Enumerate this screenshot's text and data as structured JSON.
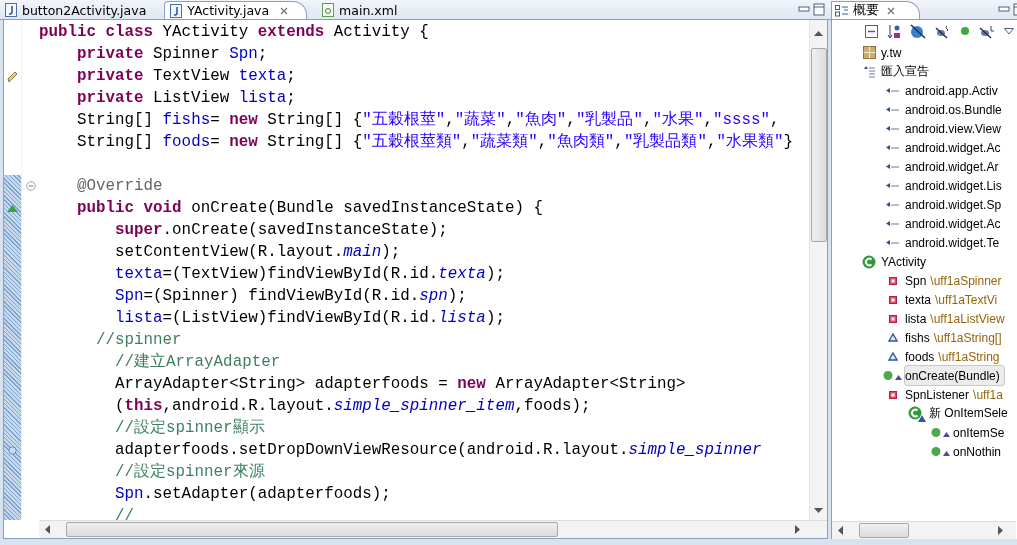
{
  "editor": {
    "tabs": [
      {
        "label": "button2Activity.java",
        "kind": "java",
        "selected": false
      },
      {
        "label": "YActivity.java",
        "kind": "java",
        "selected": true
      },
      {
        "label": "main.xml",
        "kind": "xml",
        "selected": false
      }
    ],
    "blocks": [
      {
        "in_range": false,
        "lines": [
          {
            "kind": "plain",
            "segments": [
              {
                "text": "public class ",
                "kind": "keyword"
              },
              {
                "text": "YActivity ",
                "kind": "plain"
              },
              {
                "text": "extends ",
                "kind": "keyword"
              },
              {
                "text": "Activity {",
                "kind": "plain"
              }
            ]
          },
          {
            "kind": "plain",
            "segments": [
              {
                "text": "    private ",
                "kind": "keyword"
              },
              {
                "text": "Spinner ",
                "kind": "plain"
              },
              {
                "text": "Spn",
                "kind": "field"
              },
              {
                "text": ";",
                "kind": "plain"
              }
            ]
          },
          {
            "kind": "task",
            "segments": [
              {
                "text": "    private ",
                "kind": "keyword"
              },
              {
                "text": "TextView ",
                "kind": "plain"
              },
              {
                "text": "texta",
                "kind": "field"
              },
              {
                "text": ";",
                "kind": "plain"
              }
            ]
          },
          {
            "kind": "plain",
            "segments": [
              {
                "text": "    private ",
                "kind": "keyword"
              },
              {
                "text": "ListView ",
                "kind": "plain"
              },
              {
                "text": "lista",
                "kind": "field"
              },
              {
                "text": ";",
                "kind": "plain"
              }
            ]
          },
          {
            "kind": "plain",
            "segments": [
              {
                "text": "    String[] ",
                "kind": "plain"
              },
              {
                "text": "fishs",
                "kind": "field"
              },
              {
                "text": "= ",
                "kind": "plain"
              },
              {
                "text": "new ",
                "kind": "keyword"
              },
              {
                "text": "String[] {",
                "kind": "plain"
              },
              {
                "text": "\"五穀根莖\"",
                "kind": "string"
              },
              {
                "text": ",",
                "kind": "plain"
              },
              {
                "text": "\"蔬菜\"",
                "kind": "string"
              },
              {
                "text": ",",
                "kind": "plain"
              },
              {
                "text": "\"魚肉\"",
                "kind": "string"
              },
              {
                "text": ",",
                "kind": "plain"
              },
              {
                "text": "\"乳製品\"",
                "kind": "string"
              },
              {
                "text": ",",
                "kind": "plain"
              },
              {
                "text": "\"水果\"",
                "kind": "string"
              },
              {
                "text": ",",
                "kind": "plain"
              },
              {
                "text": "\"ssss\"",
                "kind": "string"
              },
              {
                "text": ",",
                "kind": "plain"
              }
            ]
          },
          {
            "kind": "plain",
            "segments": [
              {
                "text": "    String[] ",
                "kind": "plain"
              },
              {
                "text": "foods",
                "kind": "field"
              },
              {
                "text": "= ",
                "kind": "plain"
              },
              {
                "text": "new ",
                "kind": "keyword"
              },
              {
                "text": "String[] {",
                "kind": "plain"
              },
              {
                "text": "\"五穀根莖類\"",
                "kind": "string"
              },
              {
                "text": ",",
                "kind": "plain"
              },
              {
                "text": "\"蔬菜類\"",
                "kind": "string"
              },
              {
                "text": ",",
                "kind": "plain"
              },
              {
                "text": "\"魚肉類\"",
                "kind": "string"
              },
              {
                "text": ",",
                "kind": "plain"
              },
              {
                "text": "\"乳製品類\"",
                "kind": "string"
              },
              {
                "text": ",",
                "kind": "plain"
              },
              {
                "text": "\"水果類\"",
                "kind": "string"
              },
              {
                "text": "}",
                "kind": "plain"
              }
            ]
          },
          {
            "kind": "plain"
          }
        ]
      },
      {
        "in_range": true,
        "lines": [
          {
            "kind": "fold",
            "segments": [
              {
                "text": "    @Override",
                "kind": "annotation"
              }
            ]
          },
          {
            "kind": "override",
            "segments": [
              {
                "text": "    public void ",
                "kind": "keyword"
              },
              {
                "text": "onCreate(Bundle savedInstanceState) {",
                "kind": "plain"
              }
            ]
          },
          {
            "kind": "plain",
            "segments": [
              {
                "text": "        super",
                "kind": "keyword"
              },
              {
                "text": ".onCreate(savedInstanceState);",
                "kind": "plain"
              }
            ]
          },
          {
            "kind": "plain",
            "segments": [
              {
                "text": "        setContentView(R.layout.",
                "kind": "plain"
              },
              {
                "text": "main",
                "kind": "static"
              },
              {
                "text": ");",
                "kind": "plain"
              }
            ]
          },
          {
            "kind": "plain",
            "segments": [
              {
                "text": "        texta",
                "kind": "field"
              },
              {
                "text": "=(TextView)findViewById(R.id.",
                "kind": "plain"
              },
              {
                "text": "texta",
                "kind": "static"
              },
              {
                "text": ");",
                "kind": "plain"
              }
            ]
          },
          {
            "kind": "plain",
            "segments": [
              {
                "text": "        Spn",
                "kind": "field"
              },
              {
                "text": "=(Spinner) findViewById(R.id.",
                "kind": "plain"
              },
              {
                "text": "spn",
                "kind": "static"
              },
              {
                "text": ");",
                "kind": "plain"
              }
            ]
          },
          {
            "kind": "plain",
            "segments": [
              {
                "text": "        lista",
                "kind": "field"
              },
              {
                "text": "=(ListView)findViewById(R.id.",
                "kind": "plain"
              },
              {
                "text": "lista",
                "kind": "static"
              },
              {
                "text": ");",
                "kind": "plain"
              }
            ]
          },
          {
            "kind": "plain",
            "segments": [
              {
                "text": "      //spinner",
                "kind": "comment"
              }
            ]
          },
          {
            "kind": "plain",
            "segments": [
              {
                "text": "        //建立ArrayAdapter",
                "kind": "comment"
              }
            ]
          },
          {
            "kind": "plain",
            "segments": [
              {
                "text": "        ArrayAdapter<String> adapterfoods = ",
                "kind": "plain"
              },
              {
                "text": "new ",
                "kind": "keyword"
              },
              {
                "text": "ArrayAdapter<String>",
                "kind": "plain"
              }
            ]
          },
          {
            "kind": "plain",
            "segments": [
              {
                "text": "        (",
                "kind": "plain"
              },
              {
                "text": "this",
                "kind": "keyword"
              },
              {
                "text": ",android.R.layout.",
                "kind": "plain"
              },
              {
                "text": "simple_spinner_item",
                "kind": "static"
              },
              {
                "text": ",foods);",
                "kind": "plain"
              }
            ]
          },
          {
            "kind": "plain",
            "segments": [
              {
                "text": "        //設定spinner顯示",
                "kind": "comment"
              }
            ]
          },
          {
            "kind": "occurrence",
            "segments": [
              {
                "text": "        adapterfoods.setDropDownViewResource(android.R.layout.",
                "kind": "plain"
              },
              {
                "text": "simple_spinner",
                "kind": "static"
              }
            ]
          },
          {
            "kind": "plain",
            "segments": [
              {
                "text": "        //設定spinner來源",
                "kind": "comment"
              }
            ]
          },
          {
            "kind": "plain",
            "segments": [
              {
                "text": "        Spn",
                "kind": "field"
              },
              {
                "text": ".setAdapter(adapterfoods);",
                "kind": "plain"
              }
            ]
          },
          {
            "kind": "plain",
            "segments": [
              {
                "text": "        //",
                "kind": "comment"
              }
            ]
          }
        ]
      }
    ]
  },
  "outline": {
    "tab": {
      "label": "概要",
      "selected": true
    },
    "items": [
      {
        "label": "y.tw",
        "kind": "package",
        "selected": false
      },
      {
        "label": "匯入宣告",
        "kind": "import-group",
        "selected": false,
        "children": [
          {
            "label": "android.app.Activ",
            "kind": "import",
            "selected": false
          },
          {
            "label": "android.os.Bundle",
            "kind": "import",
            "selected": false
          },
          {
            "label": "android.view.View",
            "kind": "import",
            "selected": false
          },
          {
            "label": "android.widget.Ac",
            "kind": "import",
            "selected": false
          },
          {
            "label": "android.widget.Ar",
            "kind": "import",
            "selected": false
          },
          {
            "label": "android.widget.Lis",
            "kind": "import",
            "selected": false
          },
          {
            "label": "android.widget.Sp",
            "kind": "import",
            "selected": false
          },
          {
            "label": "android.widget.Ac",
            "kind": "import",
            "selected": false
          },
          {
            "label": "android.widget.Te",
            "kind": "import",
            "selected": false
          }
        ]
      },
      {
        "label": "YActivity",
        "kind": "class",
        "selected": false,
        "children": [
          {
            "label": "Spn",
            "type": "\\uff1aSpinner",
            "kind": "private-field",
            "selected": false
          },
          {
            "label": "texta",
            "type": "\\uff1aTextVi",
            "kind": "private-field",
            "selected": false
          },
          {
            "label": "lista",
            "type": "\\uff1aListView",
            "kind": "private-field",
            "selected": false
          },
          {
            "label": "fishs",
            "type": "\\uff1aString[]",
            "kind": "field",
            "selected": false
          },
          {
            "label": "foods",
            "type": "\\uff1aString",
            "kind": "field",
            "selected": false
          },
          {
            "label": "onCreate(Bundle)",
            "kind": "override-method",
            "selected": true
          },
          {
            "label": "SpnListener",
            "type": "\\uff1a",
            "kind": "private-field",
            "selected": false,
            "children": [
              {
                "label": "新 OnItemSele",
                "kind": "anonymous-class",
                "selected": false,
                "children": [
                  {
                    "label": "onItemSe",
                    "kind": "override-method",
                    "selected": false
                  },
                  {
                    "label": "onNothin",
                    "kind": "override-method",
                    "selected": false
                  }
                ]
              }
            ]
          }
        ]
      }
    ]
  }
}
